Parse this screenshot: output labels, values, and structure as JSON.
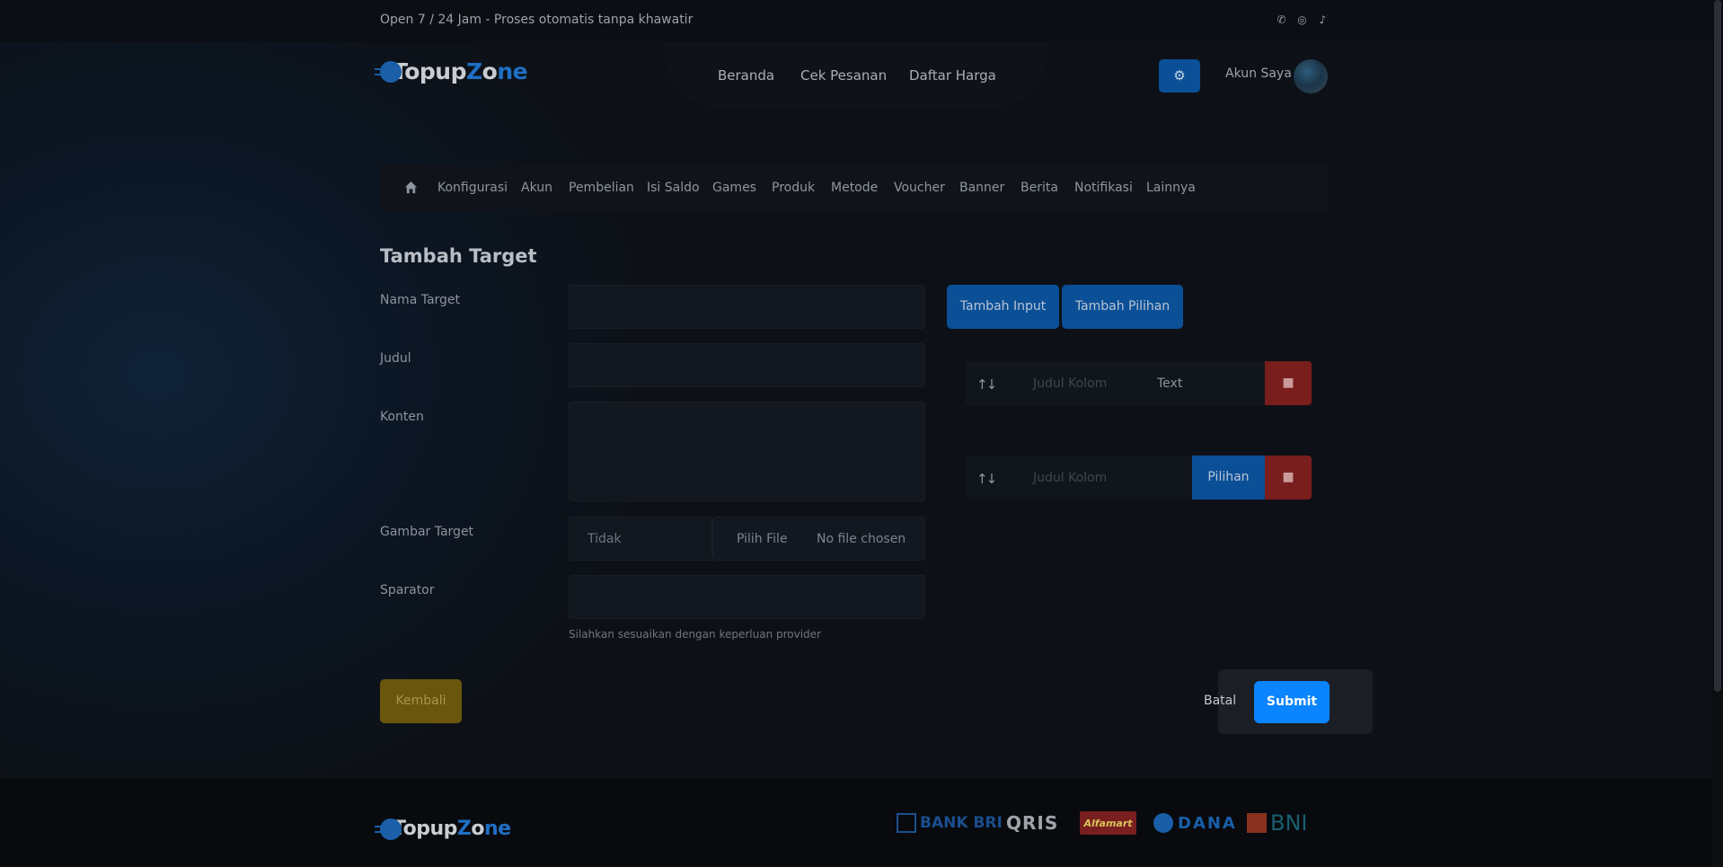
{
  "topbar": {
    "text": "Open 7 / 24 Jam - Proses otomatis tanpa khawatir",
    "socials": [
      "whatsapp-icon",
      "instagram-icon",
      "tiktok-icon"
    ]
  },
  "brand": {
    "name_a": "Topup",
    "name_z": "Z",
    "name_o": "o",
    "name_b": "ne"
  },
  "nav": {
    "items": [
      "Beranda",
      "Cek Pesanan",
      "Daftar Harga"
    ]
  },
  "account": {
    "label": "Akun Saya"
  },
  "admin_menu": {
    "items": [
      "Konfigurasi",
      "Akun",
      "Pembelian",
      "Isi Saldo",
      "Games",
      "Produk",
      "Metode",
      "Voucher",
      "Banner",
      "Berita",
      "Notifikasi",
      "Lainnya"
    ]
  },
  "form": {
    "title": "Tambah Target",
    "labels": {
      "nama": "Nama Target",
      "judul": "Judul",
      "konten": "Konten",
      "gambar": "Gambar Target",
      "sparator": "Sparator"
    },
    "gambar_select": "Tidak",
    "file_button": "Pilih File",
    "file_status": "No file chosen",
    "help": "Silahkan sesuaikan dengan keperluan provider"
  },
  "builder": {
    "add_input": "Tambah Input",
    "add_choice": "Tambah Pilihan",
    "rows": [
      {
        "placeholder": "Judul Kolom",
        "type": "Text"
      },
      {
        "placeholder": "Judul Kolom",
        "type": "Pilihan"
      }
    ]
  },
  "actions": {
    "back": "Kembali",
    "cancel": "Batal",
    "submit": "Submit"
  },
  "payments": [
    "BANK BRI",
    "QRIS",
    "Alfamart",
    "DANA",
    "BNI"
  ],
  "colors": {
    "primary": "#0a84ff",
    "primary_dim": "#0b4f97",
    "danger": "#7a1d1d",
    "warning": "#6b560e"
  }
}
